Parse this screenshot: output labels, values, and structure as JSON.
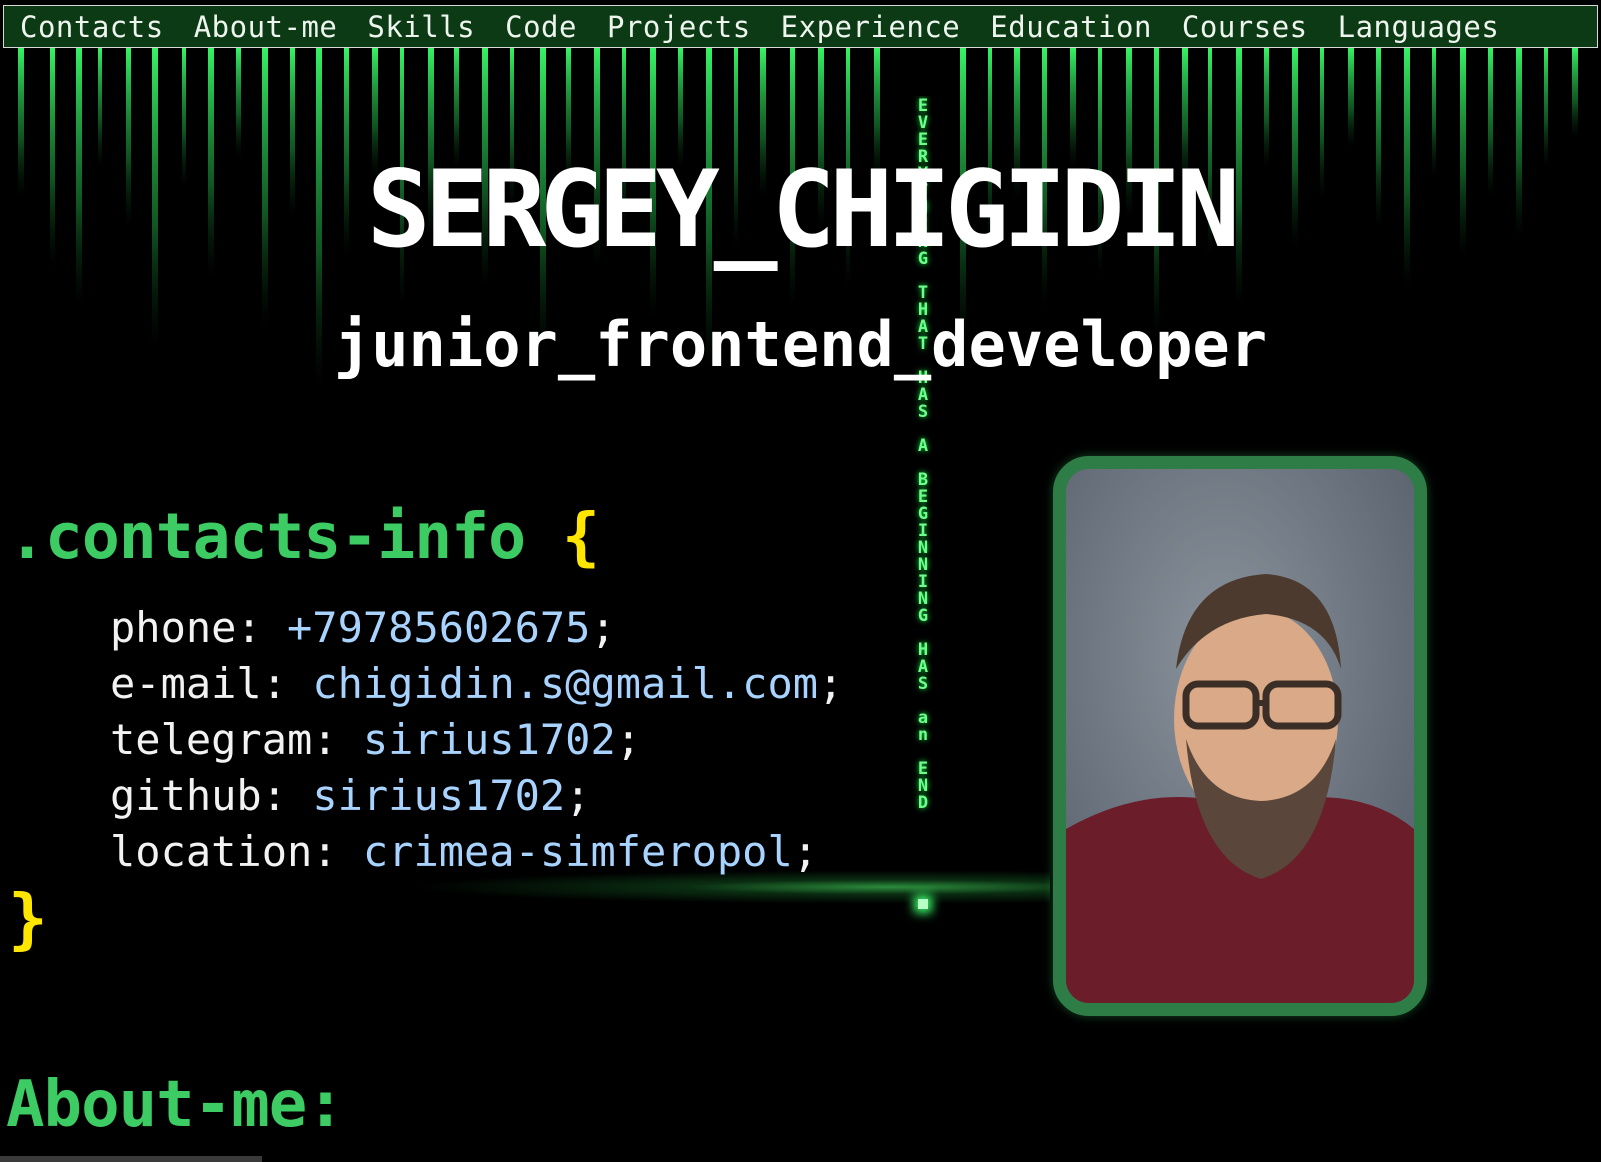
{
  "nav": {
    "items": [
      "Contacts",
      "About-me",
      "Skills",
      "Code",
      "Projects",
      "Experience",
      "Education",
      "Courses",
      "Languages"
    ]
  },
  "header": {
    "name": "SERGEY_CHIGIDIN",
    "role": "junior_frontend_developer"
  },
  "background": {
    "vertical_message": "EVERYTHING THAT HAS A BEGINNING HAS an END"
  },
  "contacts": {
    "selector": ".contacts-info",
    "open_brace": "{",
    "close_brace": "}",
    "items": [
      {
        "key": "phone:",
        "value": "+79785602675",
        "end": ";"
      },
      {
        "key": "e-mail:",
        "value": "chigidin.s@gmail.com",
        "end": ";"
      },
      {
        "key": "telegram:",
        "value": "sirius1702",
        "end": ";"
      },
      {
        "key": "github:",
        "value": "sirius1702",
        "end": ";"
      },
      {
        "key": "location:",
        "value": "crimea-simferopol",
        "end": ";"
      }
    ]
  },
  "about": {
    "title": "About-me:"
  },
  "colors": {
    "accent_green": "#3ccc63",
    "brace_yellow": "#ffe600",
    "value_blue": "#a9d3ff",
    "nav_bg": "#0b3a14",
    "photo_border": "#2f7d46"
  }
}
